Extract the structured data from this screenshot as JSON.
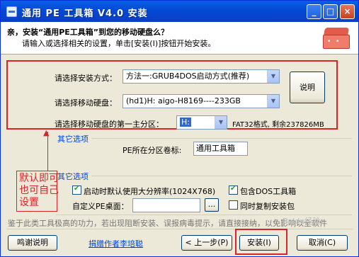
{
  "window": {
    "title": "通用 PE 工具箱 V4.0 安装",
    "controls": [
      "_",
      "□",
      "×"
    ]
  },
  "header": {
    "title": "亲，安装“通用PE工具箱”到您的移动硬盘么？",
    "subtitle": "请输入或选择相关的设置，单击[安装(I)]按钮开始安装。"
  },
  "settings": {
    "method_label": "请选择安装方式：",
    "method_value": "方法一:GRUB4DOS启动方式(推荐)",
    "disk_label": "请选择移动硬盘：",
    "disk_value": "(hd1)H: aigo-H8169----233GB",
    "partition_label": "请选择移动硬盘的第一主分区：",
    "partition_value": "H:",
    "partition_info": "FAT32格式, 剩余237826MB",
    "help_button": "说明"
  },
  "other1": {
    "group_title": "其它选项",
    "volume_label": "PE所在分区卷标:",
    "volume_value": "通用工具箱"
  },
  "other2": {
    "group_title": "其它选项",
    "hires_label": "启动时默认使用大分辨率(1024X768)",
    "hires_checked": true,
    "dos_label": "包含DOS工具箱",
    "dos_checked": true,
    "desktop_label": "自定义PE桌面：",
    "desktop_value": "",
    "browse_label": "...",
    "copy_label": "同时复制安装包",
    "copy_checked": false
  },
  "annotation": {
    "line1": "默认即可",
    "line2": "也可自己",
    "line3": "设置"
  },
  "footer": {
    "note": "鉴于此类工具极高的功力，若出现阻断安装、误报病毒提示，请直接接纳，以免影响以全软件",
    "thanks": "鸣谢说明",
    "donate": "捐赠作者李培聪",
    "back": "< 上一步(P)",
    "install": "安装(I)",
    "cancel": "取消(C)",
    "watermark": "Baidu经验"
  },
  "colors": {
    "highlight": "#d9252a",
    "title_bar": "#0349d4",
    "link": "#0046d5"
  }
}
